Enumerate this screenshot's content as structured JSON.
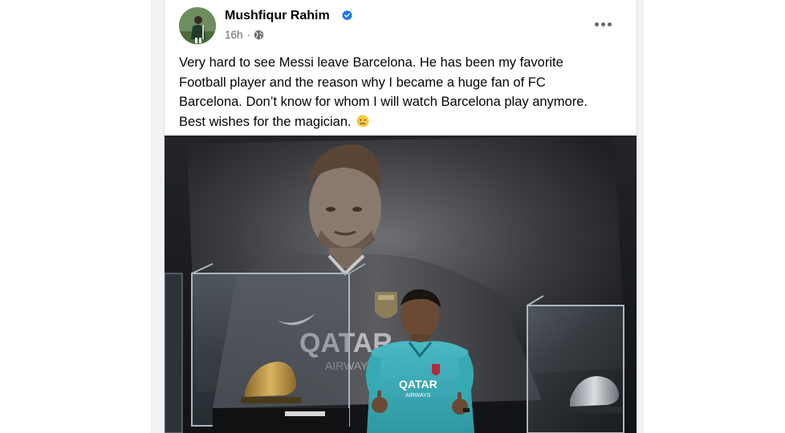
{
  "post": {
    "author": {
      "name": "Mushfiqur Rahim",
      "verified": true,
      "avatar_icon": "profile-photo"
    },
    "meta": {
      "time": "16h",
      "separator": "·",
      "audience_icon": "globe-icon"
    },
    "more_icon": "more-options-icon",
    "text": {
      "line1": "Very hard to see Messi leave Barcelona. He has been my favorite",
      "line2": "Football player and the reason why I became a huge fan of FC",
      "line3": "Barcelona. Don’t know for whom I will watch Barcelona play anymore.",
      "line4": "Best wishes for the magician.",
      "emoji": "crying-face-emoji"
    },
    "photo": {
      "description_icon": "museum-photo",
      "banner_sponsor_text": "QATAR",
      "banner_sponsor_sub": "AIRWAYS",
      "shirt_sponsor_text": "QATAR",
      "shirt_sponsor_sub": "AIRWAYS"
    }
  },
  "colors": {
    "primary_text": "#050505",
    "secondary_text": "#65676b",
    "verified_blue": "#1877f2",
    "feed_background": "#f0f2f5",
    "shirt_teal": "#35a9b4"
  }
}
